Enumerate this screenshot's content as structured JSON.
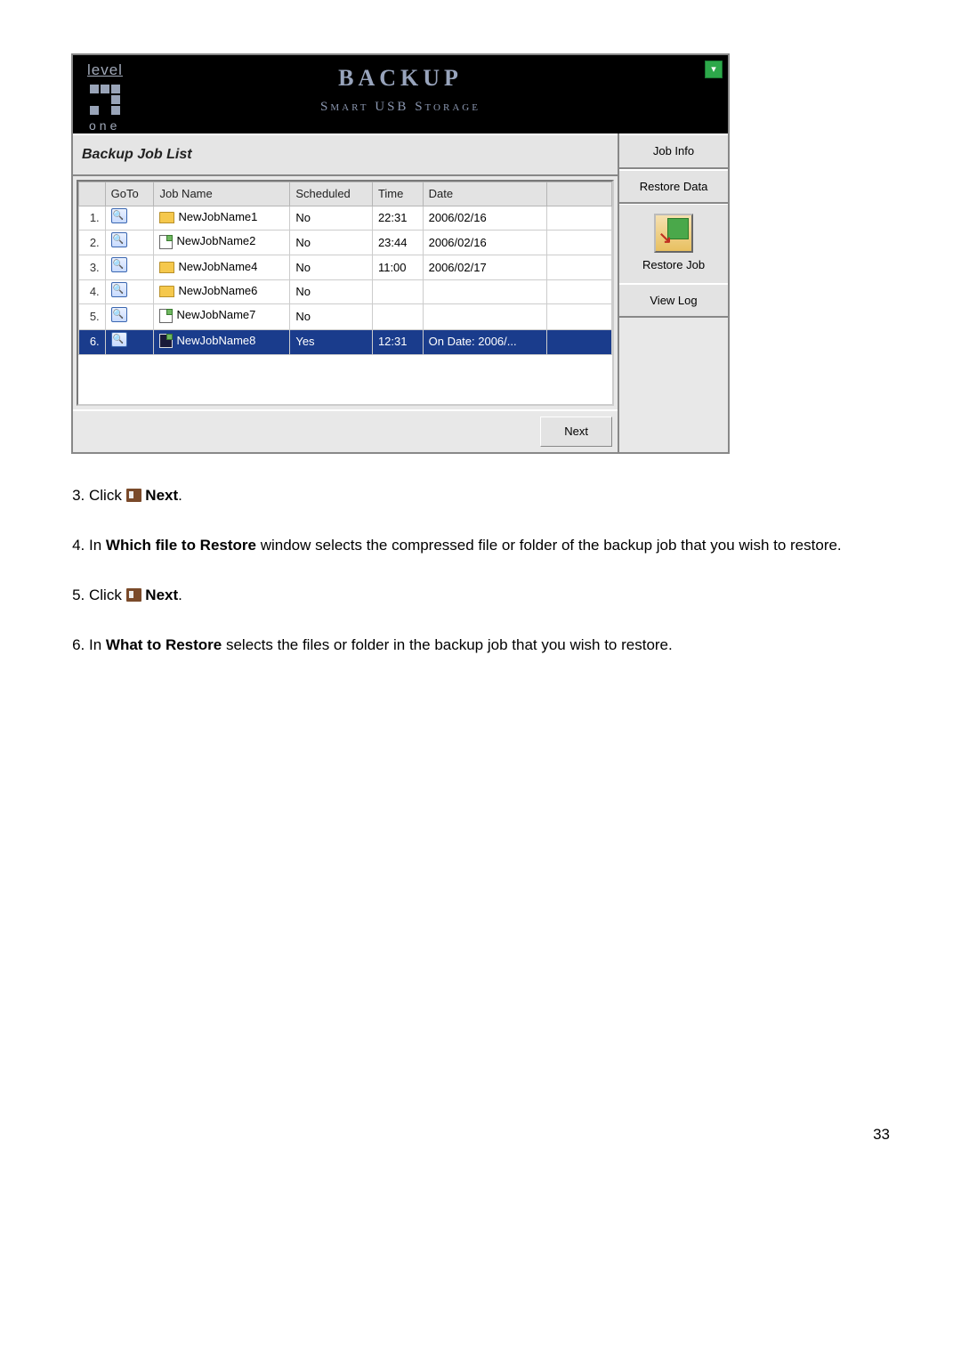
{
  "header": {
    "logo_top": "level",
    "logo_bottom": "one",
    "title": "BACKUP",
    "subtitle": "Smart USB Storage"
  },
  "panel_title": "Backup Job List",
  "columns": {
    "idx": "",
    "goto": "GoTo",
    "name": "Job Name",
    "scheduled": "Scheduled",
    "time": "Time",
    "date": "Date",
    "extra": ""
  },
  "rows": [
    {
      "idx": "1.",
      "icon": "folder",
      "name": "NewJobName1",
      "scheduled": "No",
      "time": "22:31",
      "date": "2006/02/16",
      "sel": false
    },
    {
      "idx": "2.",
      "icon": "doc",
      "name": "NewJobName2",
      "scheduled": "No",
      "time": "23:44",
      "date": "2006/02/16",
      "sel": false
    },
    {
      "idx": "3.",
      "icon": "folder",
      "name": "NewJobName4",
      "scheduled": "No",
      "time": "11:00",
      "date": "2006/02/17",
      "sel": false
    },
    {
      "idx": "4.",
      "icon": "folder",
      "name": "NewJobName6",
      "scheduled": "No",
      "time": "",
      "date": "",
      "sel": false
    },
    {
      "idx": "5.",
      "icon": "doc",
      "name": "NewJobName7",
      "scheduled": "No",
      "time": "",
      "date": "",
      "sel": false
    },
    {
      "idx": "6.",
      "icon": "docdark",
      "name": "NewJobName8",
      "scheduled": "Yes",
      "time": "12:31",
      "date": "On Date:  2006/...",
      "sel": true
    }
  ],
  "next_btn": "Next",
  "sidebar": {
    "job_info": "Job Info",
    "restore_data": "Restore Data",
    "restore_job": "Restore Job",
    "view_log": "View Log"
  },
  "instructions": {
    "i3_a": "Click ",
    "i3_b": " Next",
    "i3_c": ".",
    "i4_a": "In ",
    "i4_b": "Which file to Restore",
    "i4_c": " window selects the compressed file or folder of the backup job that you wish to restore.",
    "i5_a": "Click ",
    "i5_b": " Next",
    "i5_c": ".",
    "i6_a": "In ",
    "i6_b": "What to Restore",
    "i6_c": " selects the files or folder in the backup job that you wish to restore."
  },
  "page_number": "33"
}
